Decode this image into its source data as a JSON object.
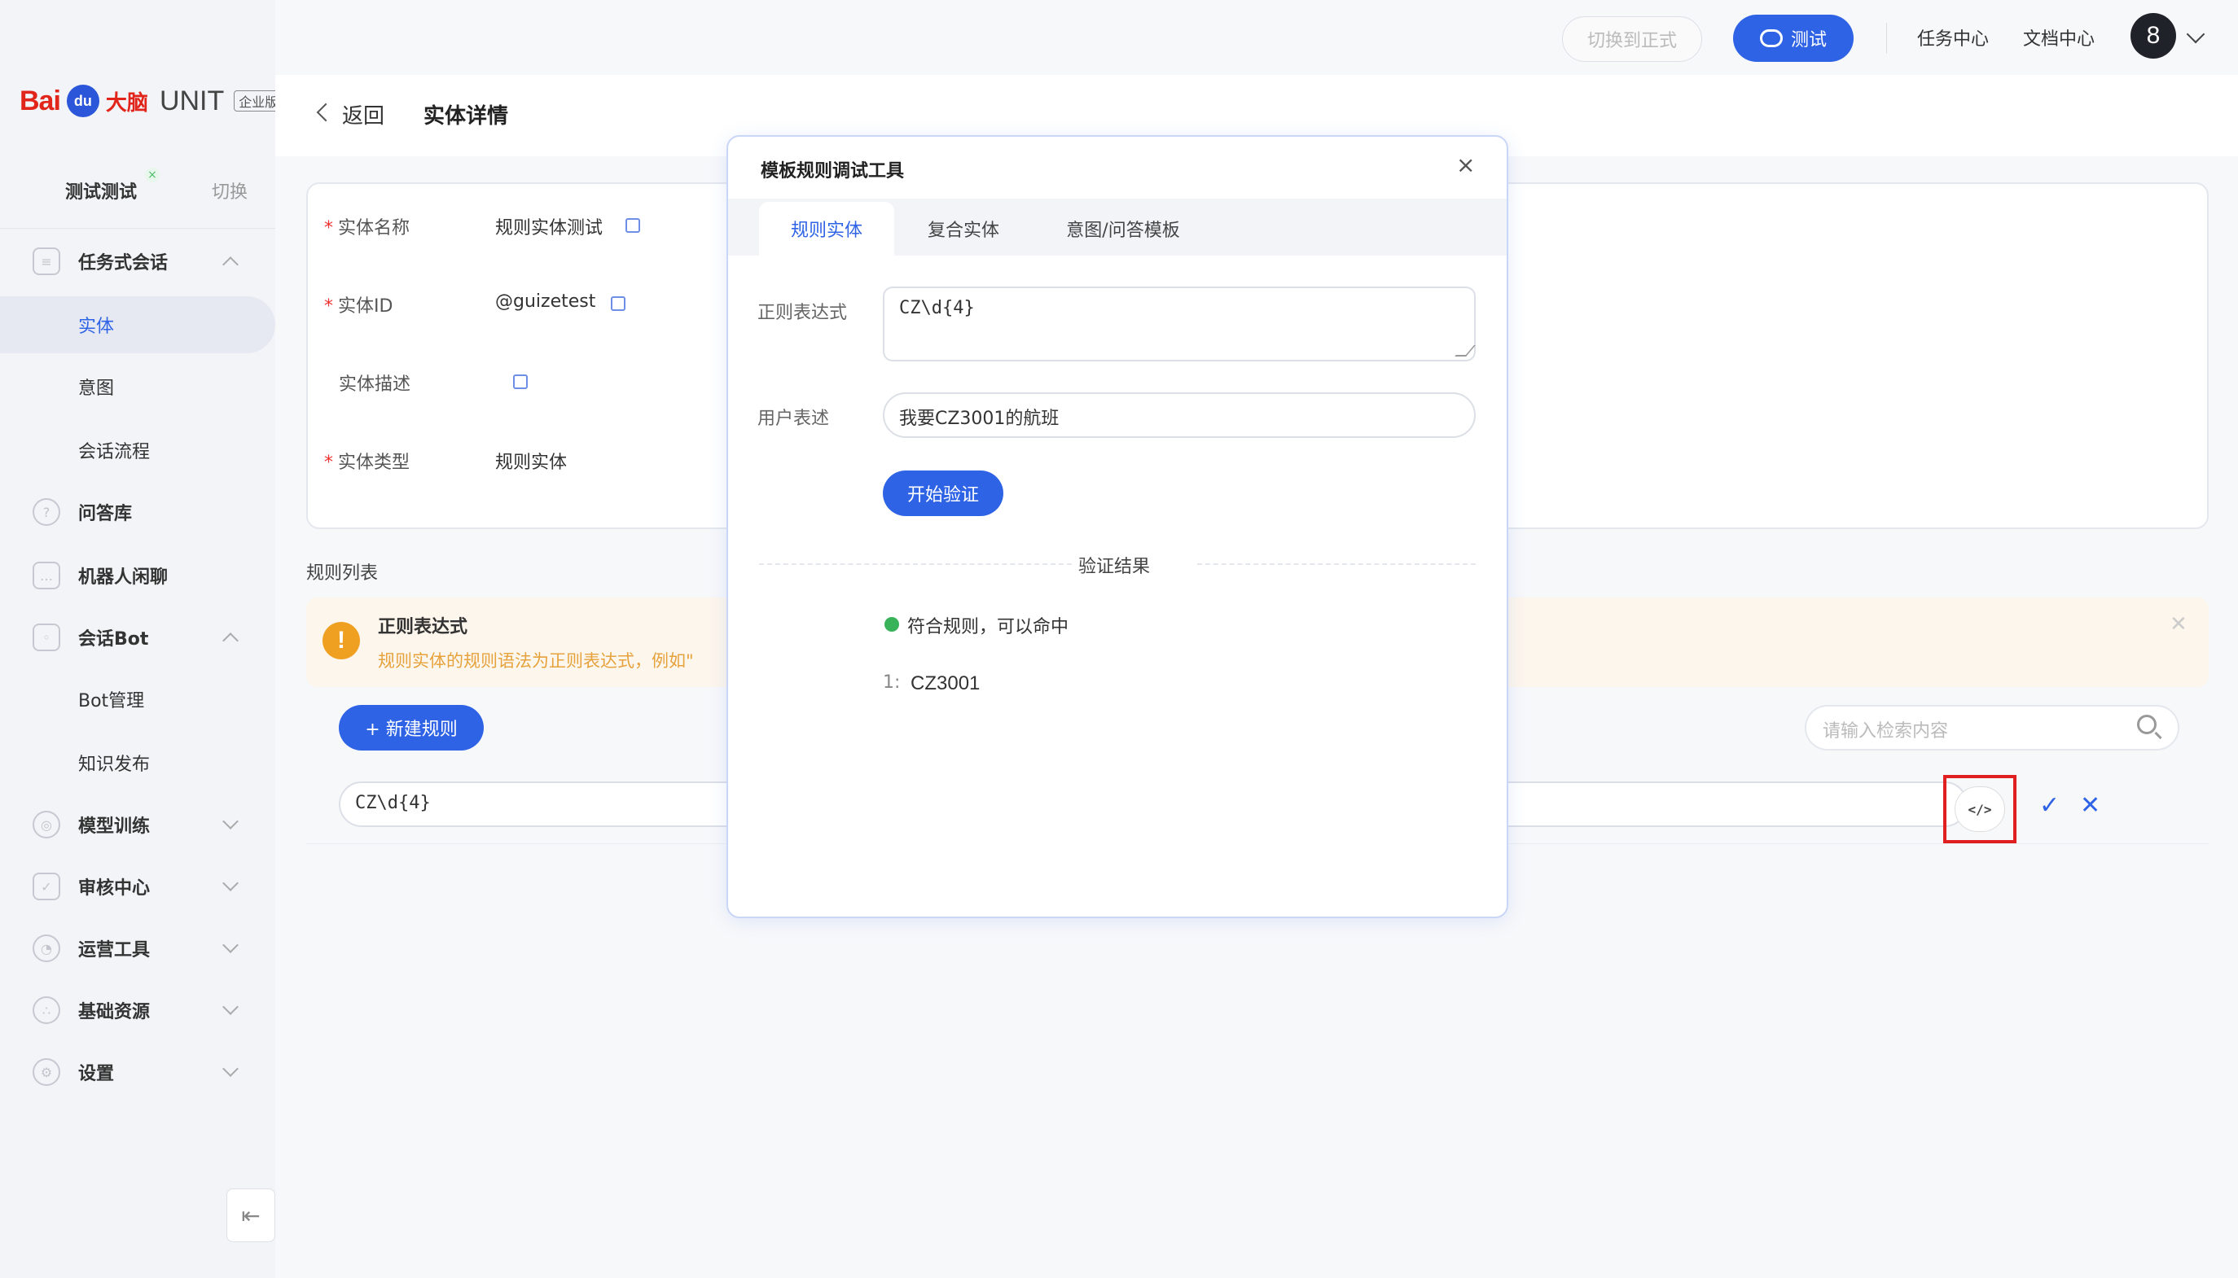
{
  "sidebar": {
    "logo": {
      "bai": "Bai",
      "paw": "du",
      "danao": "大脑",
      "unit": "UNIT",
      "edition": "企业版"
    },
    "workspace": {
      "name": "测试测试",
      "switch_label": "切换"
    },
    "nav": [
      {
        "label": "任务式会话",
        "icon": "tree-icon",
        "expanded": true
      },
      {
        "label": "实体",
        "sub": true,
        "active": true
      },
      {
        "label": "意图",
        "sub": true
      },
      {
        "label": "会话流程",
        "sub": true
      },
      {
        "label": "问答库",
        "icon": "qa-icon"
      },
      {
        "label": "机器人闲聊",
        "icon": "chat-icon"
      },
      {
        "label": "会话Bot",
        "icon": "bot-icon",
        "expanded": true
      },
      {
        "label": "Bot管理",
        "sub": true
      },
      {
        "label": "知识发布",
        "sub": true
      },
      {
        "label": "模型训练",
        "icon": "model-icon"
      },
      {
        "label": "审核中心",
        "icon": "shield-icon"
      },
      {
        "label": "运营工具",
        "icon": "ops-icon"
      },
      {
        "label": "基础资源",
        "icon": "resource-icon"
      },
      {
        "label": "设置",
        "icon": "gear-icon"
      }
    ]
  },
  "topbar": {
    "switch_prod_label": "切换到正式",
    "test_label": "测试",
    "task_center": "任务中心",
    "doc_center": "文档中心",
    "avatar_text": "8"
  },
  "header": {
    "back_label": "返回",
    "title": "实体详情"
  },
  "entity": {
    "name_label": "实体名称",
    "name_value": "规则实体测试",
    "id_label": "实体ID",
    "id_value": "@guizetest",
    "desc_label": "实体描述",
    "type_label": "实体类型",
    "type_value": "规则实体"
  },
  "rules": {
    "title": "规则列表",
    "alert_title": "正则表达式",
    "alert_desc": "规则实体的规则语法为正则表达式，例如\"",
    "new_rule_label": "+ 新建规则",
    "search_placeholder": "请输入检索内容",
    "rule_value": "CZ\\d{4}",
    "code_icon_text": "</>"
  },
  "dialog": {
    "title": "模板规则调试工具",
    "tabs": [
      "规则实体",
      "复合实体",
      "意图/问答模板"
    ],
    "regex_label": "正则表达式",
    "regex_value": "CZ\\d{4}",
    "utterance_label": "用户表述",
    "utterance_value": "我要CZ3001的航班",
    "verify_label": "开始验证",
    "result_title": "验证结果",
    "result_status": "符合规则，可以命中",
    "match_index": "1:",
    "match_value": "CZ3001"
  },
  "colors": {
    "primary": "#2f63e6",
    "success": "#38b35a",
    "warning": "#f0a020",
    "highlight": "#e02020"
  }
}
